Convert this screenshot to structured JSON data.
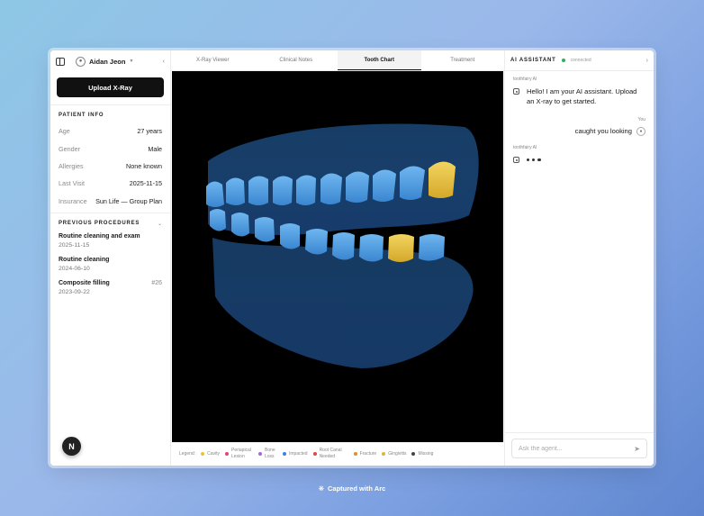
{
  "sidebar": {
    "user_name": "Aidan Jeon",
    "upload_label": "Upload X-Ray",
    "patient_info_title": "PATIENT INFO",
    "patient_info": [
      {
        "label": "Age",
        "value": "27 years"
      },
      {
        "label": "Gender",
        "value": "Male"
      },
      {
        "label": "Allergies",
        "value": "None known"
      },
      {
        "label": "Last Visit",
        "value": "2025-11-15"
      },
      {
        "label": "Insurance",
        "value": "Sun Life — Group Plan"
      }
    ],
    "procedures_title": "PREVIOUS PROCEDURES",
    "procedures": [
      {
        "name": "Routine cleaning and exam",
        "date": "2025-11-15",
        "tooth": ""
      },
      {
        "name": "Routine cleaning",
        "date": "2024-06-10",
        "tooth": ""
      },
      {
        "name": "Composite filling",
        "date": "2023-09-22",
        "tooth": "#26"
      }
    ],
    "fab_label": "N"
  },
  "main": {
    "tabs": [
      {
        "label": "X-Ray Viewer",
        "active": false
      },
      {
        "label": "Clinical Notes",
        "active": false
      },
      {
        "label": "Tooth Chart",
        "active": true
      },
      {
        "label": "Treatment",
        "active": false
      }
    ],
    "legend_title": "Legend:",
    "legend": [
      {
        "label": "Cavity",
        "color": "#e8c430"
      },
      {
        "label": "Periapical Lesion",
        "color": "#e0427a"
      },
      {
        "label": "Bone Loss",
        "color": "#a46ad8"
      },
      {
        "label": "Impacted",
        "color": "#3f7ee0"
      },
      {
        "label": "Root Canal Needed",
        "color": "#e04848"
      },
      {
        "label": "Fracture",
        "color": "#e88a2a"
      },
      {
        "label": "Gingivitis",
        "color": "#d8b83a"
      },
      {
        "label": "Missing",
        "color": "#444444"
      }
    ]
  },
  "assistant": {
    "title": "AI ASSISTANT",
    "status": "connected",
    "messages": [
      {
        "role": "bot",
        "sender": "toothfairy AI",
        "text": "Hello! I am your AI assistant. Upload an X-ray to get started."
      },
      {
        "role": "user",
        "sender": "You",
        "text": "caught you looking"
      },
      {
        "role": "bot",
        "sender": "toothfairy AI",
        "typing": true
      }
    ],
    "input_placeholder": "Ask the agent..."
  },
  "footer": {
    "captured_text": "Captured with Arc"
  },
  "colors": {
    "tooth_fill": "#3d8fd8",
    "tooth_highlight": "#e8c430",
    "viewer_bg": "#000000"
  }
}
